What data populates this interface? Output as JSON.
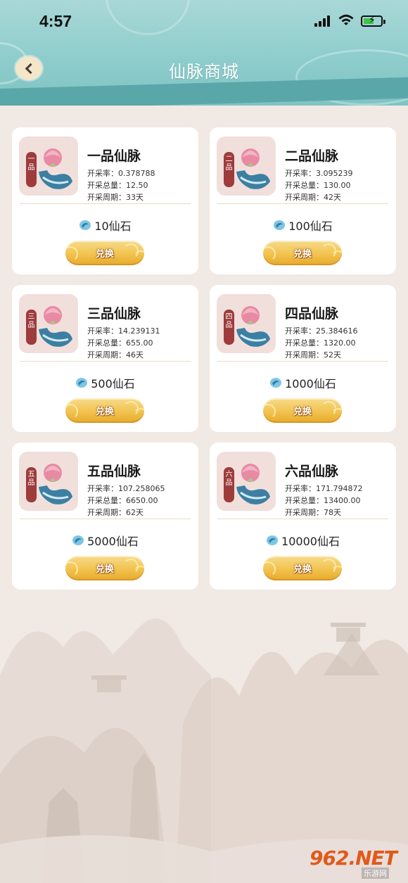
{
  "status_bar": {
    "time": "4:57"
  },
  "header": {
    "title": "仙脉商城"
  },
  "products": [
    {
      "tag": "一品",
      "name": "一品仙脉",
      "rate": "开采率：0.378788",
      "total": "开采总量：12.50",
      "period": "开采周期：33天",
      "price": "10仙石",
      "button": "兑换"
    },
    {
      "tag": "二品",
      "name": "二品仙脉",
      "rate": "开采率：3.095239",
      "total": "开采总量：130.00",
      "period": "开采周期：42天",
      "price": "100仙石",
      "button": "兑换"
    },
    {
      "tag": "三品",
      "name": "三品仙脉",
      "rate": "开采率：14.239131",
      "total": "开采总量：655.00",
      "period": "开采周期：46天",
      "price": "500仙石",
      "button": "兑换"
    },
    {
      "tag": "四品",
      "name": "四品仙脉",
      "rate": "开采率：25.384616",
      "total": "开采总量：1320.00",
      "period": "开采周期：52天",
      "price": "1000仙石",
      "button": "兑换"
    },
    {
      "tag": "五品",
      "name": "五品仙脉",
      "rate": "开采率：107.258065",
      "total": "开采总量：6650.00",
      "period": "开采周期：62天",
      "price": "5000仙石",
      "button": "兑换"
    },
    {
      "tag": "六品",
      "name": "六品仙脉",
      "rate": "开采率：171.794872",
      "total": "开采总量：13400.00",
      "period": "开采周期：78天",
      "price": "10000仙石",
      "button": "兑换"
    }
  ],
  "watermark": {
    "brand": "962.NET",
    "sub": "乐游网"
  },
  "colors": {
    "header": "#8ecdcc",
    "button": "#f2c34e",
    "tag": "#9e3b3b",
    "background": "#f1e9e3"
  }
}
